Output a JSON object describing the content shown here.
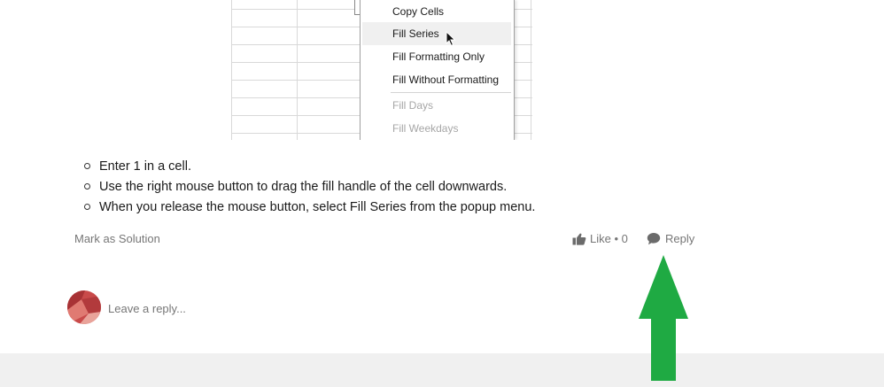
{
  "context_menu": {
    "items": [
      {
        "label": "Copy Cells",
        "state": "normal"
      },
      {
        "label": "Fill Series",
        "state": "highlighted"
      },
      {
        "label": "Fill Formatting Only",
        "state": "normal"
      },
      {
        "label": "Fill Without Formatting",
        "state": "normal"
      },
      {
        "label": "Fill Days",
        "state": "disabled"
      },
      {
        "label": "Fill Weekdays",
        "state": "disabled"
      }
    ]
  },
  "instructions": [
    "Enter 1 in a cell.",
    "Use the right mouse button to drag the fill handle of the cell downwards.",
    "When you release the mouse button, select Fill Series from the popup menu."
  ],
  "actions": {
    "mark_solution": "Mark as Solution",
    "like_label": "Like • 0",
    "reply_label": "Reply"
  },
  "reply_box": {
    "placeholder": "Leave a reply..."
  },
  "colors": {
    "arrow": "#1faa43",
    "muted_text": "#767676",
    "footer_band": "#f0f0f0"
  },
  "icons": [
    "thumbs-up-icon",
    "speech-bubble-icon",
    "mouse-cursor-icon",
    "up-arrow-icon"
  ]
}
